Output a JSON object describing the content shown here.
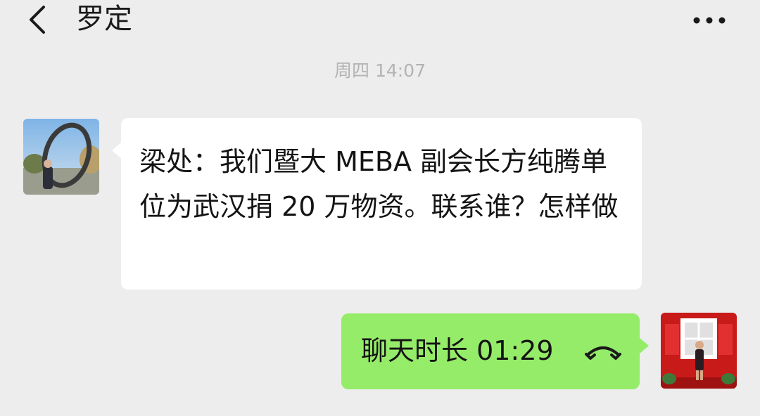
{
  "header": {
    "back_icon": "chevron-left-icon",
    "title": "罗定",
    "more_icon": "more-dots-icon"
  },
  "chat": {
    "timestamp": "周四 14:07",
    "messages": [
      {
        "sender": "other",
        "avatar": "contact-avatar-photo",
        "text": "梁处：我们暨大 MEBA 副会长方纯腾单位为武汉捐 20 万物资。联系谁？怎样做"
      },
      {
        "sender": "self",
        "avatar": "self-avatar-photo",
        "call_text": "聊天时长 01:29",
        "call_icon": "phone-hangup-icon"
      }
    ]
  },
  "colors": {
    "background": "#ededed",
    "incoming_bubble": "#ffffff",
    "outgoing_bubble": "#95ec69",
    "timestamp": "#b3b3b3"
  }
}
